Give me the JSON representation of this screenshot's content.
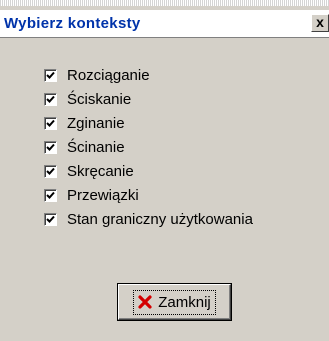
{
  "window": {
    "title": "Wybierz konteksty",
    "close_glyph": "x"
  },
  "contexts": [
    {
      "label": "Rozciąganie",
      "checked": true
    },
    {
      "label": "Ściskanie",
      "checked": true
    },
    {
      "label": "Zginanie",
      "checked": true
    },
    {
      "label": "Ścinanie",
      "checked": true
    },
    {
      "label": "Skręcanie",
      "checked": true
    },
    {
      "label": "Przewiązki",
      "checked": true
    },
    {
      "label": "Stan graniczny użytkowania",
      "checked": true
    }
  ],
  "footer": {
    "close_button_label": "Zamknij",
    "close_button_icon": "red-x-icon"
  },
  "colors": {
    "title_text": "#0033aa",
    "dialog_bg": "#d4d0c8",
    "close_icon": "#d40000"
  }
}
